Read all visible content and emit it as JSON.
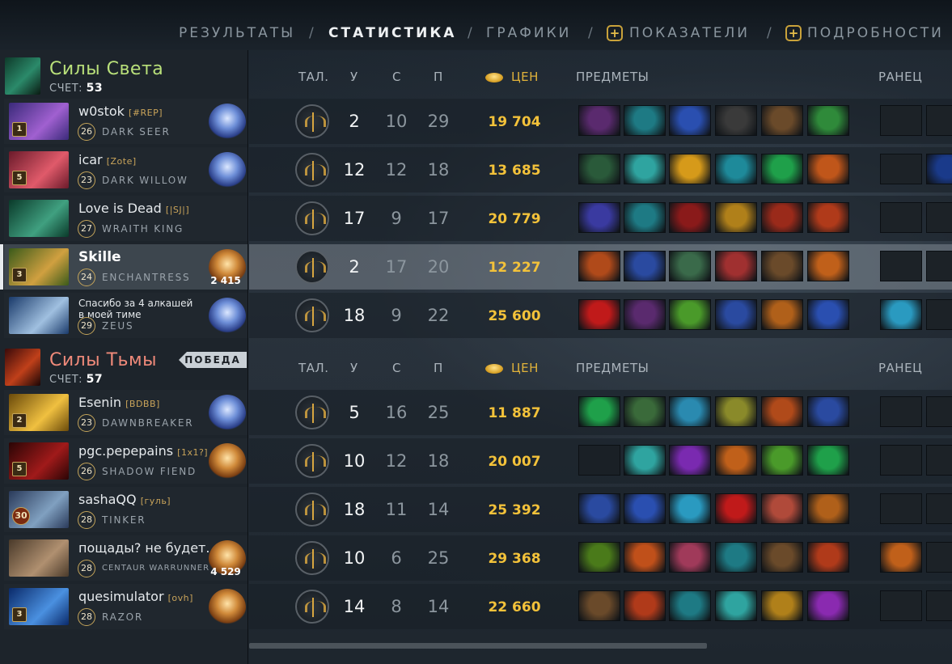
{
  "nav": {
    "tabs": [
      {
        "label": "РЕЗУЛЬТАТЫ",
        "active": false
      },
      {
        "label": "СТАТИСТИКА",
        "active": true
      },
      {
        "label": "ГРАФИКИ",
        "active": false
      },
      {
        "label": "ПОКАЗАТЕЛИ",
        "active": false,
        "icon": "plus-icon"
      },
      {
        "label": "ПОДРОБНОСТИ",
        "active": false,
        "icon": "plus-icon"
      }
    ],
    "separator": "/"
  },
  "headers": {
    "talents": "ТАЛ.",
    "kills": "У",
    "deaths": "С",
    "assists": "П",
    "networth": "ЦЕН",
    "items": "ПРЕДМЕТЫ",
    "backpack": "РАНЕЦ"
  },
  "radiant": {
    "name": "Силы Света",
    "score_label": "СЧЕТ:",
    "score": "53",
    "color": "#b9e07a",
    "players": [
      {
        "name": "w0stok",
        "tag": "[#REP]",
        "level": "26",
        "hero": "DARK SEER",
        "medal": "plat",
        "badge": "1",
        "kills": "2",
        "deaths": "10",
        "assists": "29",
        "networth": "19 704",
        "items": [
          "#5a2a6e",
          "#1e7a84",
          "#2a4fb0",
          "#3a3a3a",
          "#6a4a2a",
          "#2f8a3a"
        ],
        "backpack": [
          "",
          ""
        ]
      },
      {
        "name": "icar",
        "tag": "[Zote]",
        "level": "23",
        "hero": "DARK WILLOW",
        "medal": "plat",
        "badge": "5",
        "kills": "12",
        "deaths": "12",
        "assists": "18",
        "networth": "13 685",
        "items": [
          "#2a5a3a",
          "#2fa4a0",
          "#d69a1a",
          "#1e8a9a",
          "#1fa04a",
          "#c0561a"
        ],
        "backpack": [
          "",
          "#1a3a8a"
        ]
      },
      {
        "name": "Love is Dead",
        "tag": "[|SJ|]",
        "level": "27",
        "hero": "WRAITH KING",
        "medal": "",
        "badge": "",
        "kills": "17",
        "deaths": "9",
        "assists": "17",
        "networth": "20 779",
        "items": [
          "#3a3aa0",
          "#1e7a84",
          "#8a1a1a",
          "#b0801a",
          "#9a2a1a",
          "#b03a1a"
        ],
        "backpack": [
          "",
          ""
        ]
      },
      {
        "name": "Skille",
        "tag": "",
        "level": "24",
        "hero": "ENCHANTRESS",
        "medal": "gold",
        "medal_rank": "2 415",
        "badge": "3",
        "kills": "2",
        "deaths": "17",
        "assists": "20",
        "networth": "12 227",
        "items": [
          "#b04a1a",
          "#2a4aa0",
          "#3a6a4a",
          "#a03030",
          "#6a4a2a",
          "#c0601a"
        ],
        "backpack": [
          "",
          ""
        ]
      },
      {
        "name": "Спасибо за 4 алкашей в моей тиме",
        "tag": "",
        "level": "29",
        "hero": "ZEUS",
        "medal": "plat",
        "badge": "",
        "kills": "18",
        "deaths": "9",
        "assists": "22",
        "networth": "25 600",
        "items": [
          "#c01a1a",
          "#5a2a6e",
          "#4a9a2a",
          "#2a4aa0",
          "#b0601a",
          "#2a4fb0"
        ],
        "backpack": [
          "#2a9ac0",
          ""
        ]
      }
    ]
  },
  "dire": {
    "name": "Силы Тьмы",
    "score_label": "СЧЕТ:",
    "score": "57",
    "color": "#f08a7a",
    "winner_label": "ПОБЕДА",
    "players": [
      {
        "name": "Esenin",
        "tag": "[BDBB]",
        "level": "23",
        "hero": "DAWNBREAKER",
        "medal": "plat",
        "badge": "2",
        "kills": "5",
        "deaths": "16",
        "assists": "25",
        "networth": "11 887",
        "items": [
          "#1fa04a",
          "#3a6a3a",
          "#2a8ab0",
          "#8a8a2a",
          "#b04a1a",
          "#2a4aa0"
        ],
        "backpack": [
          "",
          ""
        ]
      },
      {
        "name": "pgc.pepepains",
        "tag": "[1x1?]",
        "level": "26",
        "hero": "SHADOW FIEND",
        "medal": "gold",
        "badge": "5",
        "kills": "10",
        "deaths": "12",
        "assists": "18",
        "networth": "20 007",
        "items": [
          "",
          "#2fa4a0",
          "#7a2ab0",
          "#c0601a",
          "#4a9a2a",
          "#1fa04a"
        ],
        "backpack": [
          "",
          ""
        ]
      },
      {
        "name": "sashaQQ",
        "tag": "[гуль]",
        "level": "28",
        "hero": "TINKER",
        "medal": "",
        "badge": "30",
        "kills": "18",
        "deaths": "11",
        "assists": "14",
        "networth": "25 392",
        "items": [
          "#2a4aa0",
          "#2a4fb0",
          "#2a9ac0",
          "#c01a1a",
          "#b04a3a",
          "#b0601a"
        ],
        "backpack": [
          "",
          ""
        ]
      },
      {
        "name": "пощады? не будет...",
        "tag": "",
        "level": "28",
        "hero": "CENTAUR WARRUNNER",
        "medal": "gold",
        "medal_rank": "4 529",
        "badge": "",
        "kills": "10",
        "deaths": "6",
        "assists": "25",
        "networth": "29 368",
        "items": [
          "#4a7a1a",
          "#c0501a",
          "#a03a5a",
          "#1e7a84",
          "#6a4a2a",
          "#b03a1a"
        ],
        "backpack": [
          "#c0601a",
          ""
        ]
      },
      {
        "name": "quesimulator",
        "tag": "[ovh]",
        "level": "28",
        "hero": "RAZOR",
        "medal": "gold",
        "badge": "3",
        "kills": "14",
        "deaths": "8",
        "assists": "14",
        "networth": "22 660",
        "items": [
          "#6a4a2a",
          "#b03a1a",
          "#1e7a84",
          "#2fa4a0",
          "#b0801a",
          "#8a2ab0"
        ],
        "backpack": [
          "",
          ""
        ]
      }
    ]
  }
}
